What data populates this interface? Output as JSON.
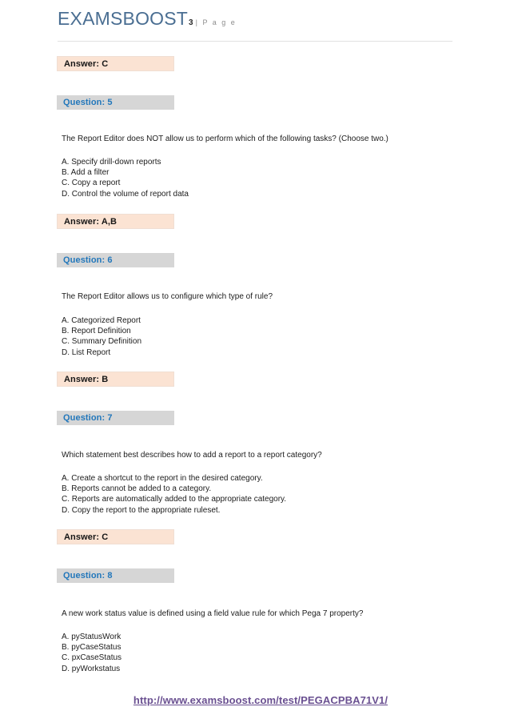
{
  "header": {
    "brand": "EXAMSBOOST",
    "page_number": "3",
    "page_label": "| P a g e"
  },
  "colors": {
    "brand": "#4a6e92",
    "answer_bg": "#fbe3d3",
    "question_bg": "#d6d6d6",
    "question_text": "#2277bb",
    "footer_link": "#6a5091"
  },
  "blocks": [
    {
      "kind": "answer",
      "label": "Answer: C"
    },
    {
      "kind": "question",
      "label": "Question: 5",
      "text": "The Report Editor does NOT allow us to perform which of the following tasks? (Choose two.)",
      "options": [
        "A. Specify drill-down reports",
        "B. Add a filter",
        "C. Copy a report",
        "D. Control the volume of report data"
      ]
    },
    {
      "kind": "answer",
      "label": "Answer: A,B"
    },
    {
      "kind": "question",
      "label": "Question: 6",
      "text": "The Report Editor allows us to configure which type of rule?",
      "options": [
        "A. Categorized Report",
        "B. Report Definition",
        "C. Summary Definition",
        "D. List Report"
      ]
    },
    {
      "kind": "answer",
      "label": "Answer: B"
    },
    {
      "kind": "question",
      "label": "Question: 7",
      "text": "Which statement best describes how to add a report to a report category?",
      "options": [
        "A. Create a shortcut to the report in the desired category.",
        "B. Reports cannot be added to a category.",
        "C. Reports are automatically added to the appropriate category.",
        "D. Copy the report to the appropriate ruleset."
      ]
    },
    {
      "kind": "answer",
      "label": "Answer: C"
    },
    {
      "kind": "question",
      "label": "Question: 8",
      "text": "A new work status value is defined using a field value rule for which Pega 7 property?",
      "options": [
        "A. pyStatusWork",
        "B. pyCaseStatus",
        "C. pxCaseStatus",
        "D. pyWorkstatus"
      ]
    }
  ],
  "footer": {
    "url": "http://www.examsboost.com/test/PEGACPBA71V1/"
  }
}
